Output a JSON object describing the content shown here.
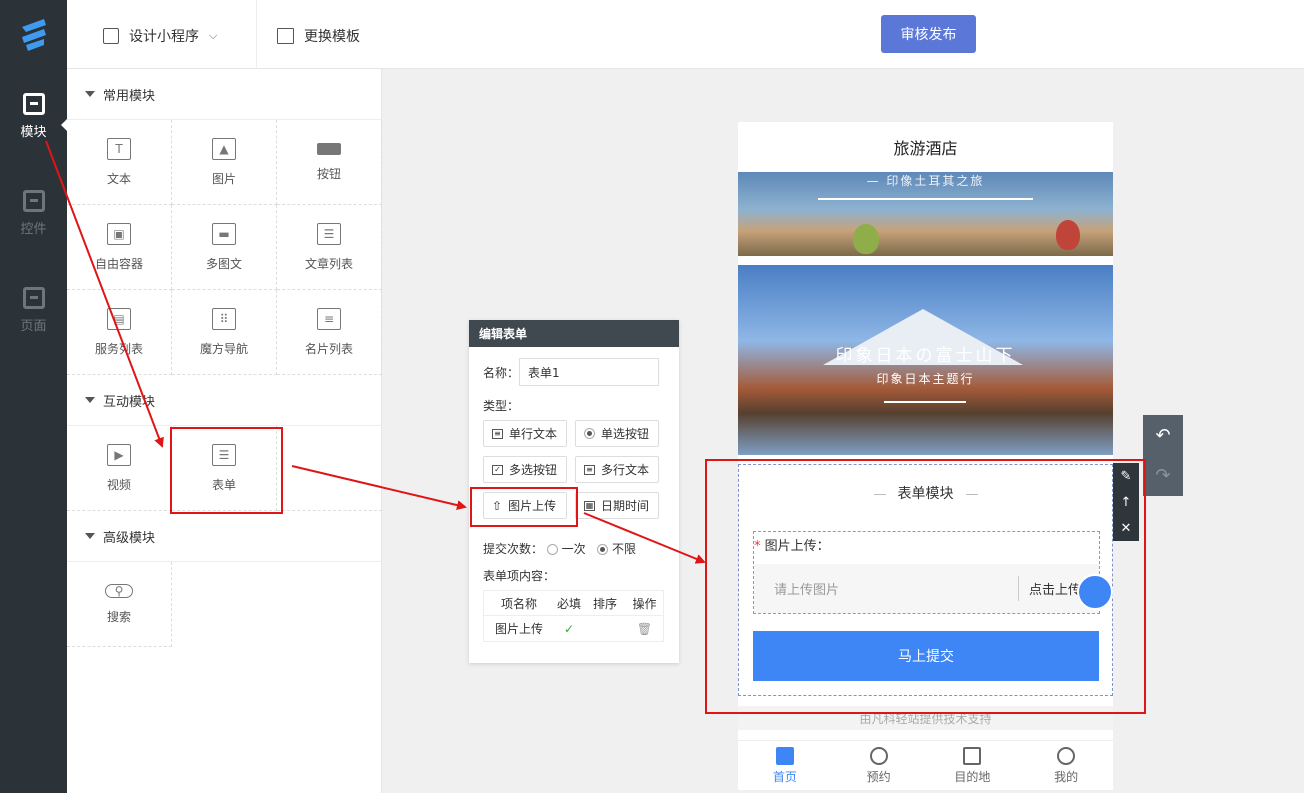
{
  "rail": {
    "items": [
      {
        "label": "模块",
        "active": true
      },
      {
        "label": "控件",
        "active": false
      },
      {
        "label": "页面",
        "active": false
      }
    ]
  },
  "topbar": {
    "design_label": "设计小程序",
    "template_label": "更换模板",
    "publish_label": "审核发布"
  },
  "panel": {
    "common_title": "常用模块",
    "common_items": [
      "文本",
      "图片",
      "按钮",
      "自由容器",
      "多图文",
      "文章列表",
      "服务列表",
      "魔方导航",
      "名片列表"
    ],
    "interactive_title": "互动模块",
    "interactive_items": [
      "视频",
      "表单"
    ],
    "advanced_title": "高级模块",
    "advanced_items": [
      "搜索"
    ]
  },
  "editform": {
    "header": "编辑表单",
    "name_label": "名称：",
    "name_value": "表单1",
    "type_label": "类型：",
    "types": [
      "单行文本",
      "单选按钮",
      "多选按钮",
      "多行文本",
      "图片上传",
      "日期时间"
    ],
    "submit_count_label": "提交次数：",
    "submit_once": "一次",
    "submit_unlimited": "不限",
    "items_label": "表单项内容：",
    "table_headers": [
      "项名称",
      "必填",
      "排序",
      "操作"
    ],
    "table_rows": [
      {
        "name": "图片上传",
        "required": "✓"
      }
    ]
  },
  "phone": {
    "title": "旅游酒店",
    "banner1_sub": "— 印像土耳其之旅",
    "banner2_big": "印象日本の富士山下",
    "banner2_small": "印象日本主题行",
    "form_title": "表单模块",
    "upload_label": "图片上传：",
    "upload_required": "*",
    "upload_placeholder": "请上传图片",
    "upload_action": "点击上传",
    "submit_label": "马上提交",
    "support_text": "由凡科轻站提供技术支持",
    "tabs": [
      "首页",
      "预约",
      "目的地",
      "我的"
    ]
  },
  "colors": {
    "rail_bg": "#2b3238",
    "publish_bg": "#5b78d9",
    "submit_bg": "#3e86f5",
    "annotation_red": "#e01515"
  }
}
